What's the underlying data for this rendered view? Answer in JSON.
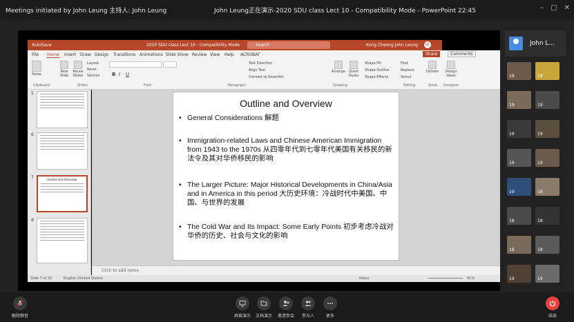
{
  "meeting": {
    "title_left": "Meetings initiated by John Leung   主持人: John Leung",
    "title_center": "John Leung正在演示-2020 SDU class Lect 10  -  Compatibility Mode - PowerPoint 22:45",
    "window_controls": [
      "–",
      "□",
      "✕"
    ]
  },
  "ppt": {
    "titlebar": {
      "autosave": "AutoSave",
      "filename": "2020 SDU class Lect 10 - Compatibility Mode",
      "search": "Search",
      "user": "Kong Cheong John Leung",
      "initials": "KC"
    },
    "menu": [
      "File",
      "Home",
      "Insert",
      "Draw",
      "Design",
      "Transitions",
      "Animations",
      "Slide Show",
      "Review",
      "View",
      "Help",
      "ACROBAT"
    ],
    "share_label": "Share",
    "comments_label": "Comments",
    "ribbon": {
      "groups": [
        "Clipboard",
        "Slides",
        "Font",
        "Paragraph",
        "Drawing",
        "Editing",
        "Voice",
        "Designer"
      ],
      "buttons": {
        "paste": "Paste",
        "new_slide": "New Slide",
        "reuse_slides": "Reuse Slides",
        "layout": "Layout",
        "reset": "Reset",
        "section": "Section",
        "text_direction": "Text Direction",
        "align_text": "Align Text",
        "convert_smartart": "Convert to SmartArt",
        "arrange": "Arrange",
        "quick_styles": "Quick Styles",
        "shape_fill": "Shape Fill",
        "shape_outline": "Shape Outline",
        "shape_effects": "Shape Effects",
        "find": "Find",
        "replace": "Replace",
        "select": "Select",
        "dictate": "Dictate",
        "design_ideas": "Design Ideas"
      }
    },
    "thumbnails": [
      {
        "number": "5",
        "selected": false,
        "title": ""
      },
      {
        "number": "6",
        "selected": false,
        "title": ""
      },
      {
        "number": "7",
        "selected": true,
        "title": "Outline and Overview"
      },
      {
        "number": "8",
        "selected": false,
        "title": ""
      }
    ],
    "slide": {
      "title": "Outline and Overview",
      "bullets": [
        "General Considerations 解题",
        "Immigration-related Laws and Chinese American Immigration from 1943 to the 1970s 从四零年代到七零年代美国有关移民的新法令及其对华侨移民的影响",
        "The Larger Picture: Major Historical Developments in China/Asia and in America in this period 大历史环境：冷战时代中美国、中国、与世界的发展",
        "The Cold War and Its Impact: Some Early Points 初步考虑冷战对华侨的历史、社会与文化的影响"
      ]
    },
    "notes_placeholder": "Click to add notes",
    "status": {
      "slide_info": "Slide 7 of 32",
      "language": "English (United States)",
      "notes": "Notes",
      "zoom": "91%"
    }
  },
  "participants": {
    "main_name": "John L...",
    "tiles": [
      "19",
      "18",
      "19",
      "19",
      "19",
      "19",
      "19",
      "19",
      "19",
      "18",
      "18",
      "18",
      "18",
      "18",
      "19",
      "19",
      "19",
      "19",
      "19",
      "19",
      "18",
      "19"
    ]
  },
  "toolbar": {
    "mute": "解除静音",
    "share_screen": "屏幕演示",
    "share_doc": "文档演示",
    "invite": "邀请参会",
    "participants": "参与人",
    "more": "更多",
    "leave": "结束"
  },
  "colors": {
    "ppt_accent": "#b7472a",
    "end_button": "#e64340",
    "meeting_bg": "#222222"
  }
}
